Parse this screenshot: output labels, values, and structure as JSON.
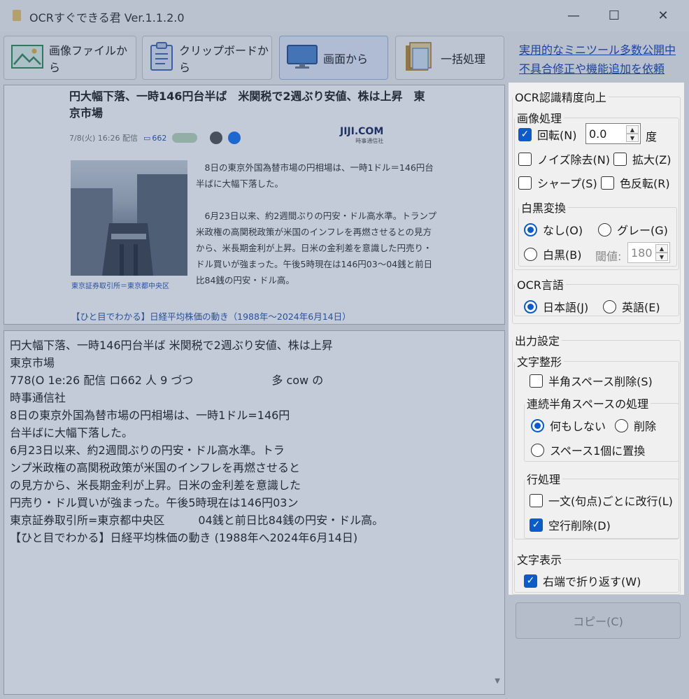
{
  "window": {
    "title": "OCRすぐできる君 Ver.1.1.2.0",
    "minimize": "—",
    "maximize": "☐",
    "close": "✕"
  },
  "toolbar": {
    "from_file": "画像ファイルから",
    "from_clipboard": "クリップボードから",
    "from_screen": "画面から",
    "batch": "一括処理"
  },
  "links": {
    "tools": "実用的なミニツール多数公開中",
    "request": "不具合修正や機能追加を依頼"
  },
  "preview": {
    "headline": "円大幅下落、一時146円台半ば　米関税で2週ぶり安値、株は上昇　東京市場",
    "meta_date": "7/8(火) 16:26 配信",
    "meta_comments": "662",
    "logo": "JIJI.COM",
    "logo_sub": "時事通信社",
    "caption": "東京証券取引所＝東京都中央区",
    "para1": "　8日の東京外国為替市場の円相場は、一時1ドル＝146円台半ばに大幅下落した。",
    "para2": "　6月23日以来、約2週間ぶりの円安・ドル高水準。トランプ米政権の高関税政策が米国のインフレを再燃させるとの見方から、米長期金利が上昇。日米の金利差を意識した円売り・ドル買いが強まった。午後5時現在は146円03〜04銭と前日比84銭の円安・ドル高。",
    "footer_link": "【ひと目でわかる】日経平均株価の動き（1988年〜2024年6月14日）"
  },
  "ocr_result": {
    "lines": [
      "円大幅下落、一時146円台半ば 米関税で2週ぶり安値、株は上昇",
      "東京市場",
      "778(O 1e:26 配信 ロ662 人 9 づつ　　　　　　　多 cow の",
      "時事通信社",
      "8日の東京外国為替市場の円相場は、一時1ドル=146円",
      "台半ばに大幅下落した。",
      "6月23日以来、約2週間ぶりの円安・ドル高水準。トラ",
      "ンプ米政権の高関税政策が米国のインフレを再燃させると",
      "の見方から、米長期金利が上昇。日米の金利差を意識した",
      "円売り・ドル買いが強まった。午後5時現在は146円03ン",
      "東京証券取引所=東京都中央区　　　04銭と前日比84銭の円安・ドル高。",
      "【ひと目でわかる】日経平均株価の動き (1988年へ2024年6月14日)"
    ]
  },
  "accuracy": {
    "legend": "OCR認識精度向上",
    "image_processing": {
      "legend": "画像処理",
      "rotate_label": "回転(N)",
      "rotate_checked": true,
      "rotate_value": "0.0",
      "degree": "度",
      "denoise_label": "ノイズ除去(N)",
      "denoise_checked": false,
      "enlarge_label": "拡大(Z)",
      "enlarge_checked": false,
      "sharpen_label": "シャープ(S)",
      "sharpen_checked": false,
      "invert_label": "色反転(R)",
      "invert_checked": false,
      "binarize": {
        "legend": "白黒変換",
        "none_label": "なし(O)",
        "gray_label": "グレー(G)",
        "bw_label": "白黒(B)",
        "selected": "none",
        "threshold_label": "閾値:",
        "threshold_value": "180"
      }
    },
    "language": {
      "legend": "OCR言語",
      "japanese_label": "日本語(J)",
      "english_label": "英語(E)",
      "selected": "japanese"
    }
  },
  "output": {
    "legend": "出力設定",
    "text_format": {
      "legend": "文字整形",
      "remove_halfwidth_space_label": "半角スペース削除(S)",
      "remove_halfwidth_space_checked": false,
      "consecutive": {
        "legend": "連続半角スペースの処理",
        "nothing_label": "何もしない",
        "delete_label": "削除",
        "replace_label": "スペース1個に置換",
        "selected": "nothing"
      }
    },
    "line_processing": {
      "legend": "行処理",
      "break_per_sentence_label": "一文(句点)ごとに改行(L)",
      "break_per_sentence_checked": false,
      "remove_empty_lines_label": "空行削除(D)",
      "remove_empty_lines_checked": true
    },
    "display": {
      "legend": "文字表示",
      "wrap_label": "右端で折り返す(W)",
      "wrap_checked": true
    }
  },
  "copy_button": "コピー(C)",
  "colors": {
    "accent": "#0b5cc6",
    "link": "#1a44a8",
    "overlay": "#284678"
  }
}
